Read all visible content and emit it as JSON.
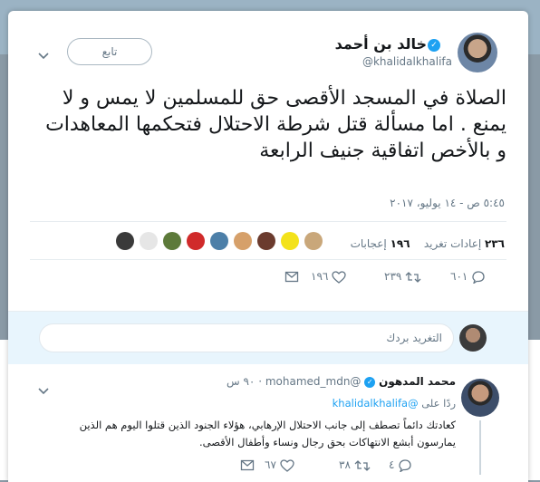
{
  "tweet": {
    "author_name": "خالد بن أحمد",
    "author_handle": "@khalidalkhalifa",
    "follow_label": "تابع",
    "text": "الصلاة في المسجد الأقصى حق للمسلمين لا يمس و لا يمنع . اما مسألة قتل شرطة الاحتلال فتحكمها المعاهدات و بالأخص اتفاقية جنيف الرابعة",
    "timestamp": "٥:٤٥ ص - ١٤ يوليو، ٢٠١٧",
    "retweets_count": "٢٣٦",
    "retweets_label": "إعادات تغريد",
    "likes_count": "١٩٦",
    "likes_label": "إعجابات",
    "actions": {
      "reply_count": "٦٠١",
      "retweet_count": "٢٣٩",
      "like_count": "١٩٦"
    }
  },
  "reply_box": {
    "placeholder": "التغريد بردك"
  },
  "reply": {
    "author_name": "محمد المدهون",
    "author_handle": "@mohamed_mdn",
    "time": "٩٠ س",
    "replying_to_label": "ردًا على",
    "replying_to_handle": "@khalidalkhalifa",
    "text": "كعادتك دائماً تصطف إلى جانب الاحتلال الإرهابي، هؤلاء الجنود الذين قتلوا اليوم هم الذين يمارسون أبشع الانتهاكات بحق رجال ونساء وأطفال الأقصى.",
    "actions": {
      "reply_count": "٤",
      "retweet_count": "٣٨",
      "like_count": "٦٧"
    }
  },
  "colors": {
    "accent": "#1da1f2",
    "muted": "#657786",
    "like_red": "#e0245e"
  }
}
